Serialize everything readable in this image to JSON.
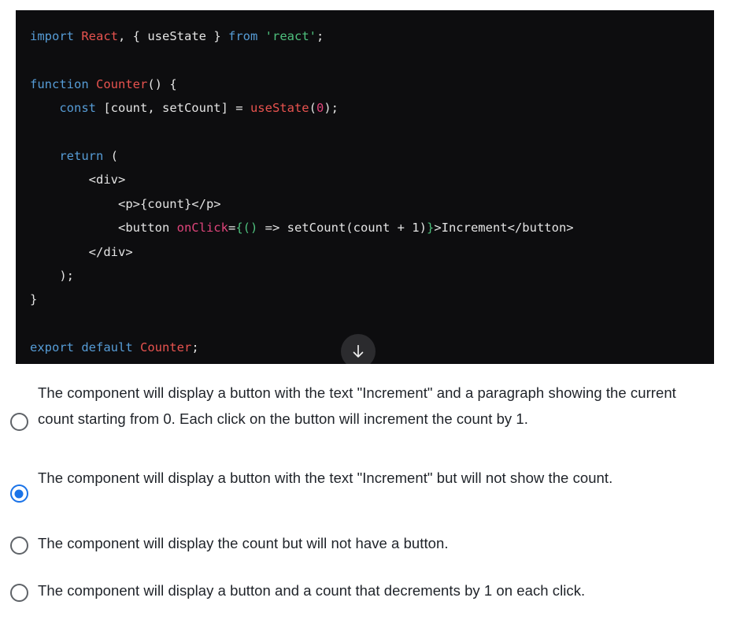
{
  "code_block": {
    "language": "jsx",
    "background": "#0d0d0f",
    "scroll_button": {
      "icon": "arrow-down-icon",
      "label": "Scroll down"
    },
    "lines": [
      [
        {
          "t": "import ",
          "c": "tok-kw"
        },
        {
          "t": "React",
          "c": "tok-type"
        },
        {
          "t": ", { useState } ",
          "c": "tok-plain"
        },
        {
          "t": "from ",
          "c": "tok-kw"
        },
        {
          "t": "'react'",
          "c": "tok-str"
        },
        {
          "t": ";",
          "c": "tok-plain"
        }
      ],
      [],
      [
        {
          "t": "function ",
          "c": "tok-kw"
        },
        {
          "t": "Counter",
          "c": "tok-type"
        },
        {
          "t": "() {",
          "c": "tok-plain"
        }
      ],
      [
        {
          "t": "    ",
          "c": "tok-plain"
        },
        {
          "t": "const ",
          "c": "tok-kw"
        },
        {
          "t": "[count, setCount] = ",
          "c": "tok-plain"
        },
        {
          "t": "useState",
          "c": "tok-type"
        },
        {
          "t": "(",
          "c": "tok-plain"
        },
        {
          "t": "0",
          "c": "tok-num"
        },
        {
          "t": ");",
          "c": "tok-plain"
        }
      ],
      [],
      [
        {
          "t": "    ",
          "c": "tok-plain"
        },
        {
          "t": "return ",
          "c": "tok-kw"
        },
        {
          "t": "(",
          "c": "tok-plain"
        }
      ],
      [
        {
          "t": "        <div>",
          "c": "tok-plain"
        }
      ],
      [
        {
          "t": "            <p>{count}</p>",
          "c": "tok-plain"
        }
      ],
      [
        {
          "t": "            <button ",
          "c": "tok-plain"
        },
        {
          "t": "onClick",
          "c": "tok-attr"
        },
        {
          "t": "=",
          "c": "tok-plain"
        },
        {
          "t": "{()",
          "c": "tok-brace"
        },
        {
          "t": " => setCount(count + ",
          "c": "tok-plain"
        },
        {
          "t": "1",
          "c": "tok-plain"
        },
        {
          "t": ")",
          "c": "tok-plain"
        },
        {
          "t": "}",
          "c": "tok-brace"
        },
        {
          "t": ">Increment</button>",
          "c": "tok-plain"
        }
      ],
      [
        {
          "t": "        </div>",
          "c": "tok-plain"
        }
      ],
      [
        {
          "t": "    );",
          "c": "tok-plain"
        }
      ],
      [
        {
          "t": "}",
          "c": "tok-plain"
        }
      ],
      [],
      [
        {
          "t": "export default ",
          "c": "tok-kw"
        },
        {
          "t": "Counter",
          "c": "tok-type"
        },
        {
          "t": ";",
          "c": "tok-plain"
        }
      ]
    ]
  },
  "question": {
    "selected_index": 1,
    "accent_color": "#1a73e8",
    "radio_color": "#5f6368",
    "options": [
      {
        "label": "The component will display a button with the text \"Increment\" and a paragraph showing the current count starting from 0. Each click on the button will increment the count by 1.",
        "selected": false
      },
      {
        "label": "The component will display a button with the text \"Increment\" but will not show the count.",
        "selected": true
      },
      {
        "label": "The component will display the count but will not have a button.",
        "selected": false
      },
      {
        "label": "The component will display a button and a count that decrements by 1 on each click.",
        "selected": false
      }
    ]
  }
}
